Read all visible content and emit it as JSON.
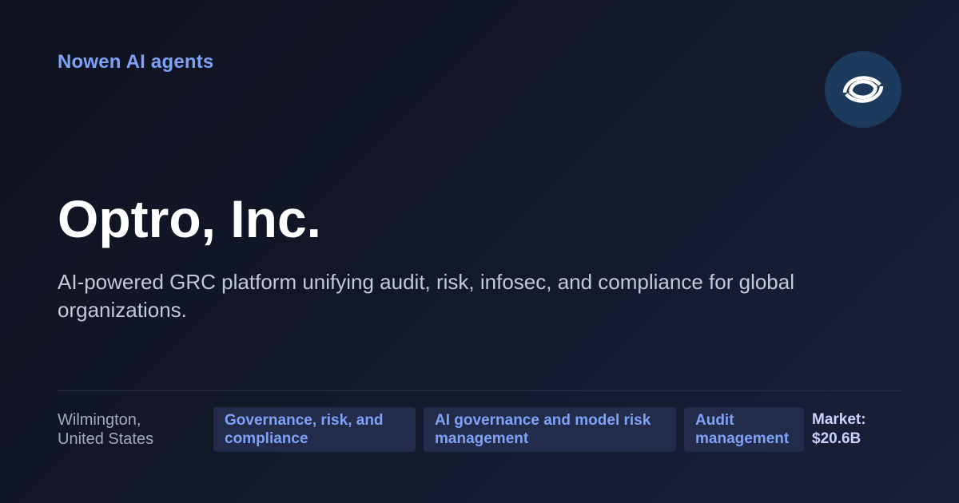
{
  "header": {
    "brand": "Nowen AI agents",
    "logo_icon": "nowen-swirl-logo-icon"
  },
  "company": {
    "name": "Optro, Inc.",
    "description": "AI-powered GRC platform unifying audit, risk, infosec, and compliance for global organizations."
  },
  "footer": {
    "location_line1": "Wilmington,",
    "location_line2": "United States",
    "tags": [
      {
        "label": "Governance, risk, and compliance"
      },
      {
        "label": "AI governance and model risk management"
      },
      {
        "label": "Audit management"
      }
    ],
    "market_label": "Market:",
    "market_value": "$20.6B"
  },
  "colors": {
    "accent": "#7ea2f7",
    "background": "#121728",
    "tag_background": "#222c4a",
    "logo_background": "#1b3a5c"
  }
}
